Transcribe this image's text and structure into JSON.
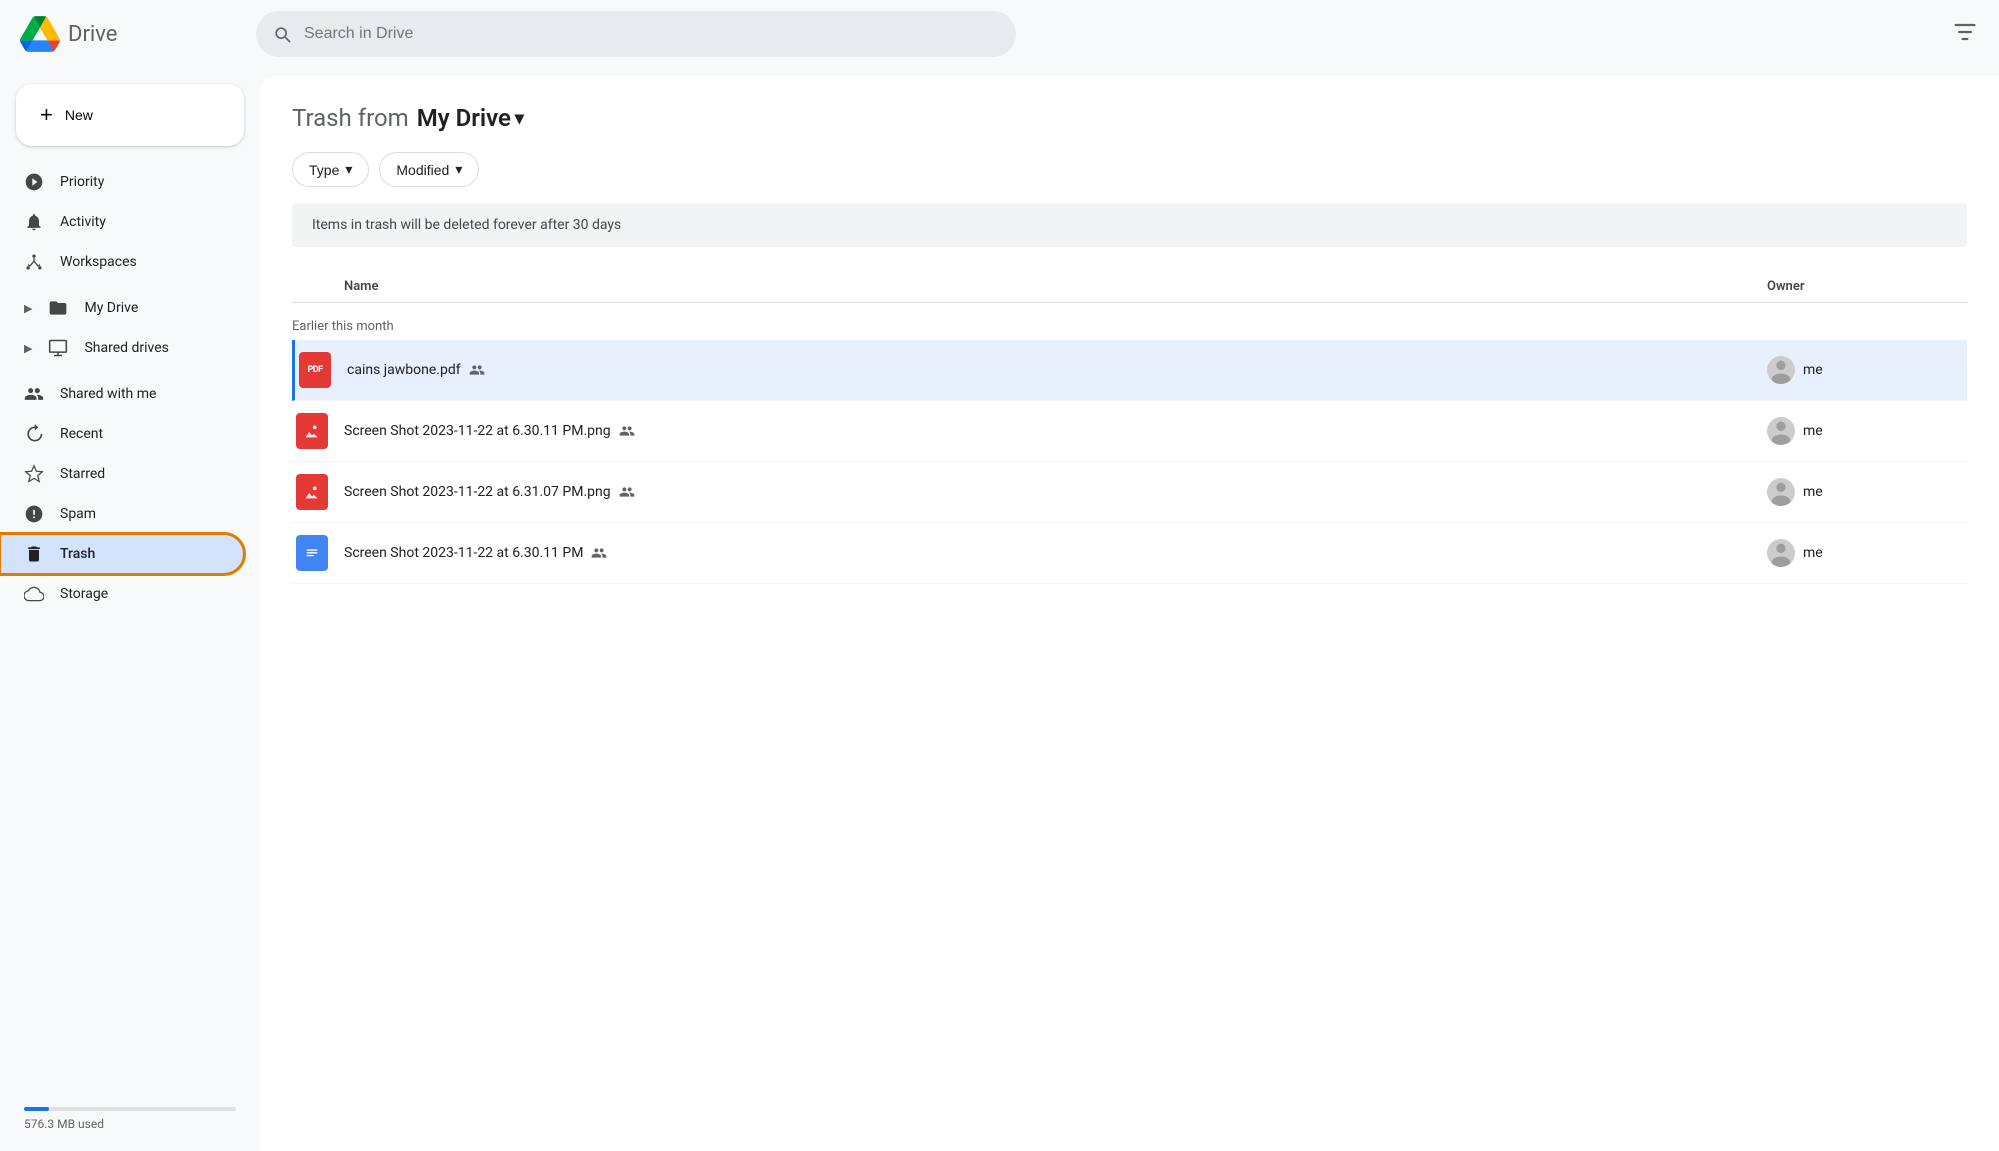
{
  "topbar": {
    "logo_text": "Drive",
    "search_placeholder": "Search in Drive"
  },
  "sidebar": {
    "new_button": "New",
    "items": [
      {
        "id": "priority",
        "label": "Priority",
        "icon": "☑",
        "active": false
      },
      {
        "id": "activity",
        "label": "Activity",
        "icon": "🔔",
        "active": false
      },
      {
        "id": "workspaces",
        "label": "Workspaces",
        "icon": "⊙",
        "active": false
      },
      {
        "id": "my-drive",
        "label": "My Drive",
        "icon": "📁",
        "active": false,
        "has_chevron": true
      },
      {
        "id": "shared-drives",
        "label": "Shared drives",
        "icon": "🖥",
        "active": false,
        "has_chevron": true
      },
      {
        "id": "shared-with-me",
        "label": "Shared with me",
        "icon": "👤",
        "active": false
      },
      {
        "id": "recent",
        "label": "Recent",
        "icon": "🕐",
        "active": false
      },
      {
        "id": "starred",
        "label": "Starred",
        "icon": "☆",
        "active": false
      },
      {
        "id": "spam",
        "label": "Spam",
        "icon": "⚠",
        "active": false
      },
      {
        "id": "trash",
        "label": "Trash",
        "icon": "🗑",
        "active": true,
        "highlighted": true
      },
      {
        "id": "storage",
        "label": "Storage",
        "icon": "☁",
        "active": false
      }
    ],
    "storage_used": "576.3 MB used",
    "storage_percent": 12
  },
  "content": {
    "title_static": "Trash from",
    "title_drive": "My Drive",
    "filters": [
      {
        "id": "type",
        "label": "Type",
        "has_arrow": true
      },
      {
        "id": "modified",
        "label": "Modified",
        "has_arrow": true
      }
    ],
    "notice": "Items in trash will be deleted forever after 30 days",
    "table": {
      "col_name": "Name",
      "col_owner": "Owner"
    },
    "time_groups": [
      {
        "label": "Earlier this month",
        "files": [
          {
            "id": "f1",
            "name": "cains jawbone.pdf",
            "type": "pdf",
            "shared": true,
            "owner": "me",
            "selected": true
          },
          {
            "id": "f2",
            "name": "Screen Shot 2023-11-22 at 6.30.11 PM.png",
            "type": "image",
            "shared": true,
            "owner": "me",
            "selected": false
          },
          {
            "id": "f3",
            "name": "Screen Shot 2023-11-22 at 6.31.07 PM.png",
            "type": "image",
            "shared": true,
            "owner": "me",
            "selected": false
          },
          {
            "id": "f4",
            "name": "Screen Shot 2023-11-22 at 6.30.11 PM",
            "type": "doc",
            "shared": true,
            "owner": "me",
            "selected": false
          }
        ]
      }
    ]
  }
}
